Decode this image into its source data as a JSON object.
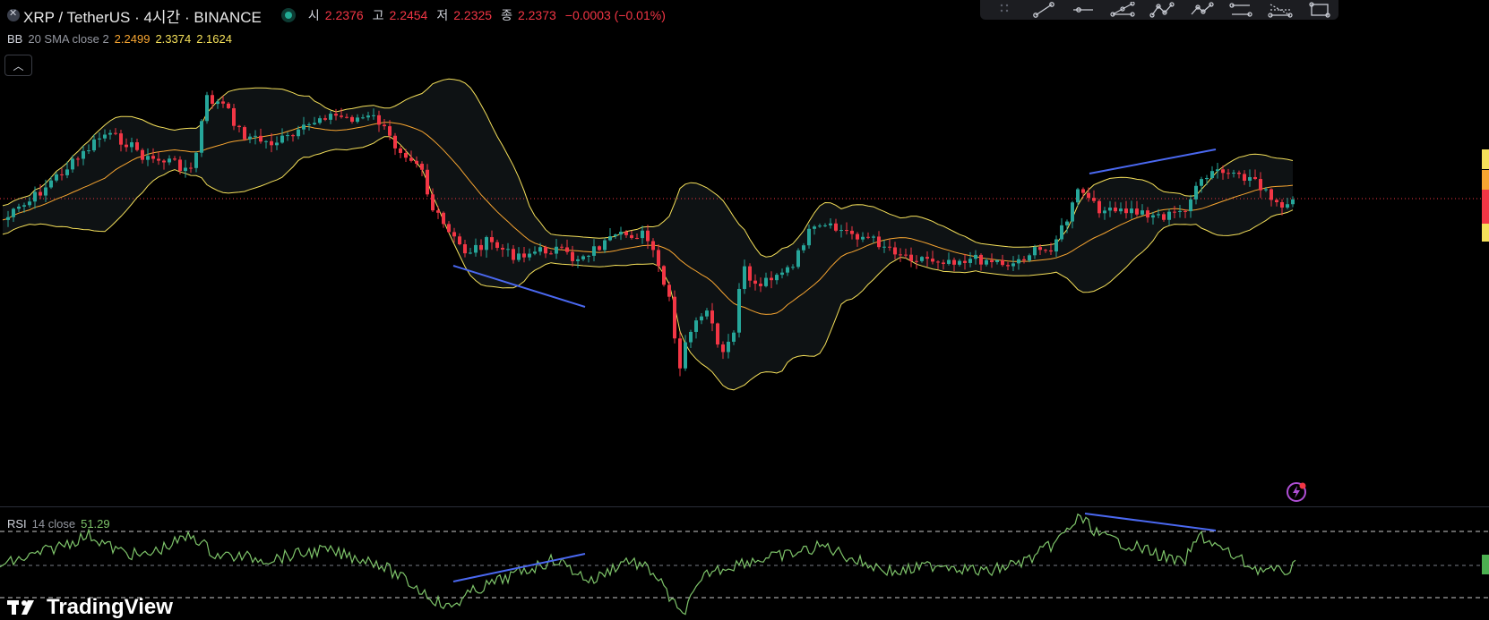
{
  "header": {
    "symbol": "XRP / TetherUS · 4시간 · BINANCE",
    "ohlc": [
      {
        "label": "시",
        "value": "2.2376"
      },
      {
        "label": "고",
        "value": "2.2454"
      },
      {
        "label": "저",
        "value": "2.2325"
      },
      {
        "label": "종",
        "value": "2.2373"
      }
    ],
    "change": "−0.0003 (−0.01%)"
  },
  "bb": {
    "name": "BB",
    "params": "20 SMA close 2",
    "basis": "2.2499",
    "upper": "2.3374",
    "lower": "2.1624"
  },
  "rsi": {
    "name": "RSI",
    "params": "14 close",
    "value": "51.29"
  },
  "watermark": "TradingView",
  "toolbar_icons": [
    "trend-line-icon",
    "horizontal-ray-icon",
    "pitchfork-icon",
    "pattern-icon",
    "zigzag-icon",
    "elliott-wave-icon",
    "path-icon",
    "fib-retracement-icon",
    "rectangle-icon"
  ],
  "colors": {
    "up": "#26a69a",
    "down": "#f23645",
    "bb_band": "#f5e05a",
    "bb_basis": "#f7a531",
    "rsi_line": "#7ec46a",
    "divergence": "#4a68f0"
  },
  "chart_data": {
    "type": "candlestick",
    "instrument": "XRP / TetherUS",
    "interval": "4시간",
    "exchange": "BINANCE",
    "last_close": 2.2373,
    "indicators": [
      {
        "name": "BB",
        "params": "20 SMA close 2",
        "basis": 2.2499,
        "upper": 2.3374,
        "lower": 2.1624
      },
      {
        "name": "RSI",
        "params": "14 close",
        "value": 51.29,
        "levels": [
          70,
          50,
          30
        ]
      }
    ]
  }
}
